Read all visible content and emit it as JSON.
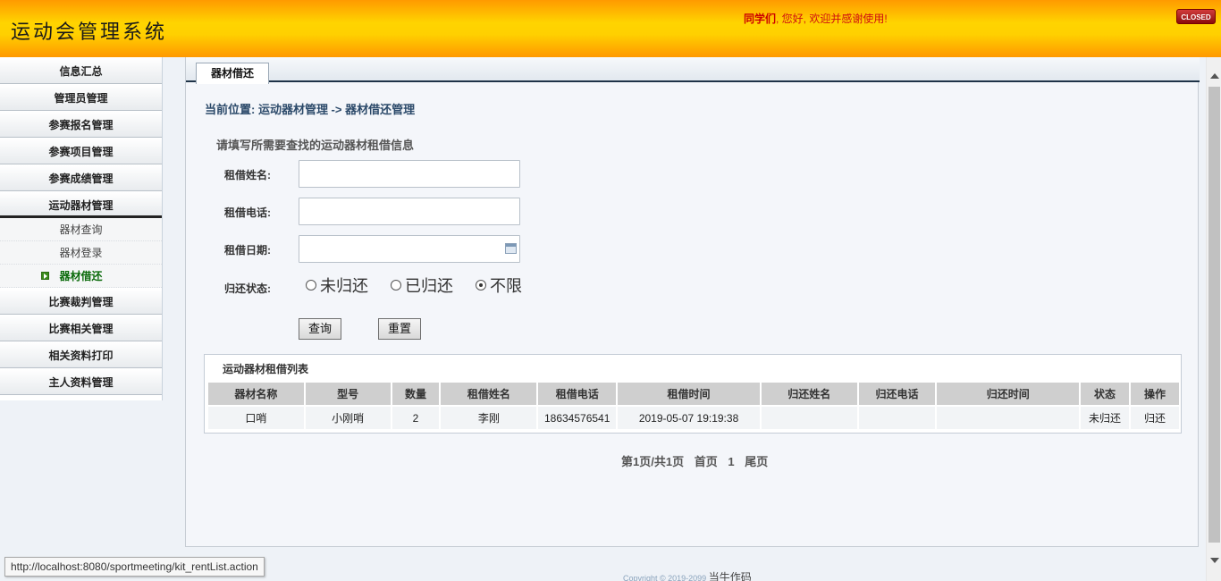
{
  "header": {
    "app_title": "运动会管理系统",
    "welcome_user": "同学们",
    "welcome_text": ", 您好, 欢迎并感谢使用!",
    "close_label": "CLOSED"
  },
  "sidebar": {
    "items": [
      {
        "label": "信息汇总"
      },
      {
        "label": "管理员管理"
      },
      {
        "label": "参赛报名管理"
      },
      {
        "label": "参赛项目管理"
      },
      {
        "label": "参赛成绩管理"
      },
      {
        "label": "运动器材管理"
      }
    ],
    "subitems": [
      {
        "label": "器材查询"
      },
      {
        "label": "器材登录"
      },
      {
        "label": "器材借还"
      }
    ],
    "items_after": [
      {
        "label": "比赛裁判管理"
      },
      {
        "label": "比赛相关管理"
      },
      {
        "label": "相关资料打印"
      },
      {
        "label": "主人资料管理"
      }
    ]
  },
  "main": {
    "tab_label": "器材借还",
    "breadcrumb": "当前位置: 运动器材管理 -> 器材借还管理",
    "form_title": "请填写所需要查找的运动器材租借信息",
    "fields": {
      "name_label": "租借姓名:",
      "phone_label": "租借电话:",
      "date_label": "租借日期:",
      "status_label": "归还状态:",
      "name_value": "",
      "phone_value": "",
      "date_value": ""
    },
    "radio_options": [
      "未归还",
      "已归还",
      "不限"
    ],
    "radio_selected": "不限",
    "query_button": "查询",
    "reset_button": "重置",
    "list_title": "运动器材租借列表",
    "table": {
      "headers": [
        "器材名称",
        "型号",
        "数量",
        "租借姓名",
        "租借电话",
        "租借时间",
        "归还姓名",
        "归还电话",
        "归还时间",
        "状态",
        "操作"
      ],
      "rows": [
        [
          "口哨",
          "小刚哨",
          "2",
          "李刚",
          "18634576541",
          "2019-05-07 19:19:38",
          "",
          "",
          "",
          "未归还",
          "归还"
        ]
      ]
    },
    "pager": {
      "info": "第1页/共1页",
      "first": "首页",
      "current": "1",
      "last": "尾页"
    }
  },
  "footer": {
    "copyright": "Copyright © 2019-2099",
    "author": "当牛作码"
  },
  "status_bar": {
    "url": "http://localhost:8080/sportmeeting/kit_rentList.action"
  }
}
